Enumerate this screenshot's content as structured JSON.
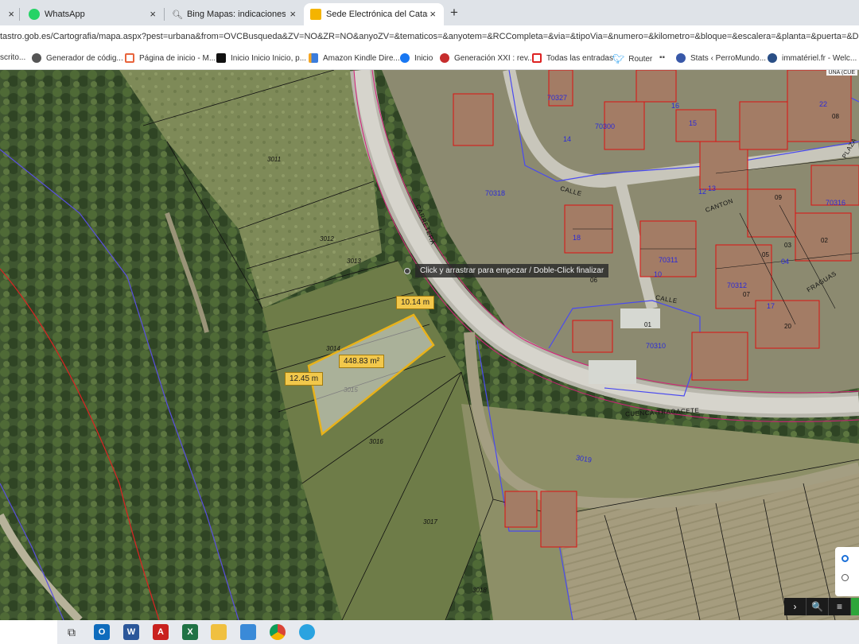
{
  "tabs": [
    {
      "label": "WhatsApp"
    },
    {
      "label": "Bing Mapas: indicaciones, plan"
    },
    {
      "label": "Sede Electrónica del Catastro"
    }
  ],
  "url": "tastro.gob.es/Cartografia/mapa.aspx?pest=urbana&from=OVCBusqueda&ZV=NO&ZR=NO&anyoZV=&tematicos=&anyotem=&RCCompleta=&via=&tipoVia=&numero=&kilometro=&bloque=&escalera=&planta=&puerta=&D...",
  "bookmarks": [
    {
      "label": "scrito..."
    },
    {
      "label": "Generador de códig..."
    },
    {
      "label": "Página de inicio - M..."
    },
    {
      "label": "Inicio Inicio Inicio, p..."
    },
    {
      "label": "Amazon Kindle Dire..."
    },
    {
      "label": "Inicio"
    },
    {
      "label": "Generación XXI : rev..."
    },
    {
      "label": "Todas las entradas"
    },
    {
      "label": "Router"
    },
    {
      "label": "Stats ‹ PerroMundo..."
    },
    {
      "label": "immatériel.fr - Welc..."
    }
  ],
  "map": {
    "top_right_label": "UNA (CUE",
    "tooltip": "Click y arrastrar para empezar / Doble-Click finalizar",
    "measurements": {
      "top": "10.14 m",
      "left": "12.45 m",
      "area": "448.83 m²"
    },
    "parcel_numbers": [
      "3011",
      "3012",
      "3013",
      "3014",
      "3015",
      "3016",
      "3017",
      "3018",
      "3019"
    ],
    "block_numbers": [
      "70327",
      "70310",
      "70312",
      "70311",
      "70316",
      "70318",
      "70300"
    ],
    "street_labels": [
      "CARRETERA",
      "CALLE",
      "CANTON",
      "FRAGUAS",
      "CALLE",
      "CUENCA-TRAGACETE",
      "PLAZA"
    ],
    "house_numbers": [
      "14",
      "16",
      "18",
      "10",
      "12",
      "08",
      "09",
      "05",
      "04",
      "03",
      "02",
      "01",
      "07",
      "06",
      "20",
      "13",
      "15",
      "17",
      "22"
    ]
  },
  "controls": {
    "next": "›",
    "zoom": "🔍",
    "layers": "≡"
  },
  "taskbar": {
    "icons": [
      "task-view",
      "outlook",
      "word",
      "acrobat",
      "excel",
      "explorer",
      "photos",
      "chrome",
      "telegram"
    ]
  }
}
